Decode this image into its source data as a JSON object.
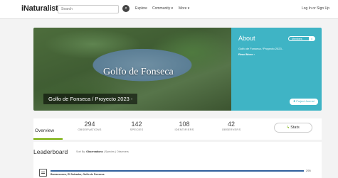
{
  "header": {
    "logo": "iNaturalist",
    "search_placeholder": "Search",
    "nav": {
      "explore": "Explore",
      "community": "Community ▾",
      "more": "More ▾"
    },
    "login": "Log In or Sign Up"
  },
  "banner": {
    "map_title": "Golfo de Fonseca",
    "project_title": "Golfo de Fonseca / Proyecto 2023 -",
    "about": {
      "title": "About",
      "members_label": "Members",
      "members_count": "4",
      "description": "Golfo de Fonseca / Proyecto 2023 -",
      "read_more": "Read More ›",
      "journal": "✚ Project Journal"
    }
  },
  "stats": {
    "overview_tab": "Overview",
    "items": [
      {
        "value": "294",
        "label": "OBSERVATIONS"
      },
      {
        "value": "142",
        "label": "SPECIES"
      },
      {
        "value": "108",
        "label": "IDENTIFIERS"
      },
      {
        "value": "42",
        "label": "OBSERVERS"
      }
    ],
    "stats_button": "Stats"
  },
  "leaderboard": {
    "title": "Leaderboard",
    "sort_prefix": "Sort By:",
    "sort_active": "Observations",
    "sort_options": "| Species | Observers",
    "rows": [
      {
        "label": "Barrancones, El Salvador, Golfo de Fonseca",
        "value": "295",
        "fraction": 1.0
      }
    ]
  },
  "colors": {
    "accent_green": "#74ac00",
    "about_teal": "#3fb4c5",
    "bar_blue": "#2f5f9c"
  }
}
